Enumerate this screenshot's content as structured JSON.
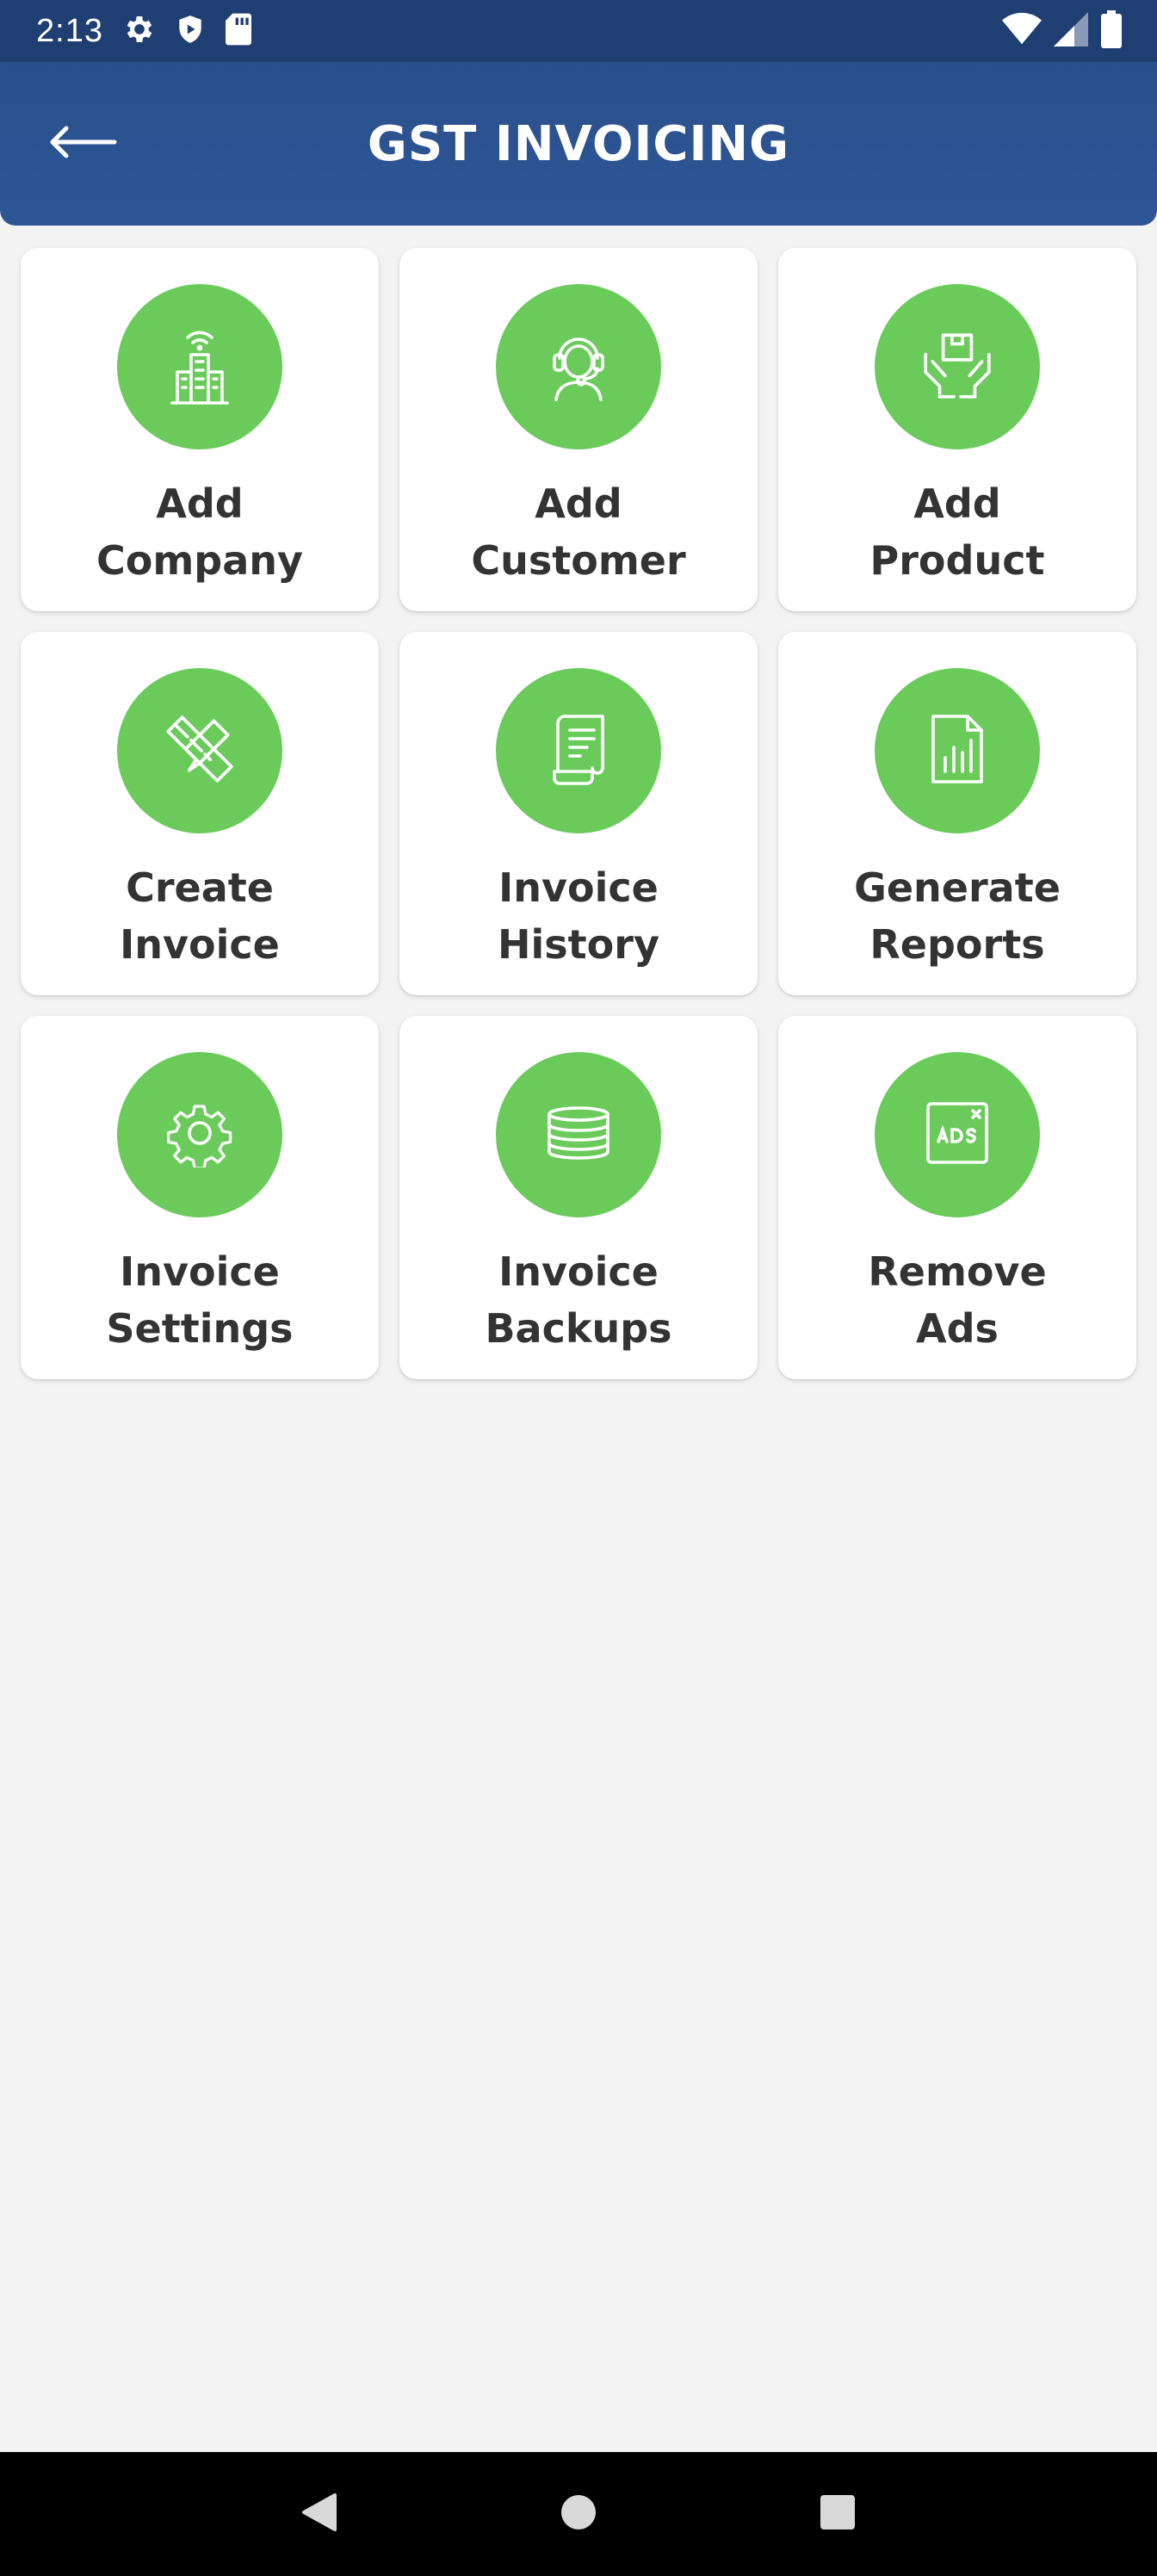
{
  "status_bar": {
    "time": "2:13",
    "icons": [
      "gear-icon",
      "shield-play-icon",
      "sd-card-icon",
      "wifi-icon",
      "signal-icon",
      "battery-icon"
    ]
  },
  "app_bar": {
    "title": "GST INVOICING",
    "back_icon": "arrow-left-icon",
    "background_color": "#2e5696"
  },
  "tiles": [
    {
      "line1": "Add",
      "line2": "Company",
      "icon": "building-icon"
    },
    {
      "line1": "Add",
      "line2": "Customer",
      "icon": "customer-support-icon"
    },
    {
      "line1": "Add",
      "line2": "Product",
      "icon": "product-box-hands-icon"
    },
    {
      "line1": "Create",
      "line2": "Invoice",
      "icon": "pen-ruler-icon"
    },
    {
      "line1": "Invoice",
      "line2": "History",
      "icon": "receipt-icon"
    },
    {
      "line1": "Generate",
      "line2": "Reports",
      "icon": "report-chart-icon"
    },
    {
      "line1": "Invoice",
      "line2": "Settings",
      "icon": "gear-icon"
    },
    {
      "line1": "Invoice",
      "line2": "Backups",
      "icon": "database-stack-icon"
    },
    {
      "line1": "Remove",
      "line2": "Ads",
      "icon": "ads-icon"
    }
  ],
  "accent_color": "#6acb5b",
  "nav_bar": {
    "icons": [
      "back-triangle-icon",
      "home-circle-icon",
      "recents-square-icon"
    ]
  }
}
